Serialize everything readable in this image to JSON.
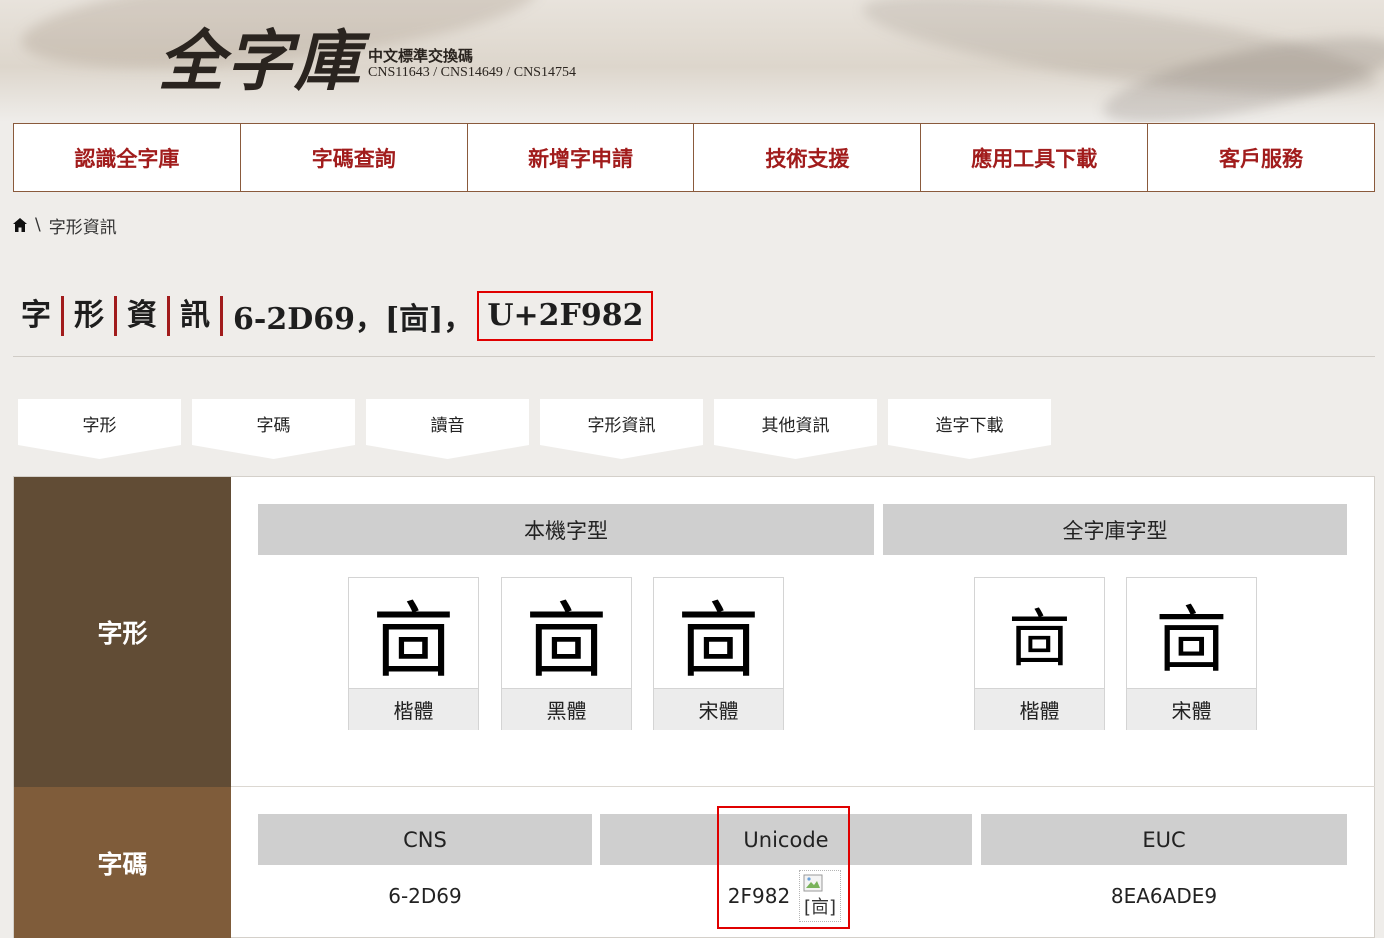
{
  "header": {
    "logo_title": "全字庫",
    "logo_subtitle": "中文標準交換碼",
    "logo_standards": "CNS11643 / CNS14649 / CNS14754"
  },
  "nav": {
    "items": [
      {
        "label": "認識全字庫"
      },
      {
        "label": "字碼查詢"
      },
      {
        "label": "新增字申請"
      },
      {
        "label": "技術支援"
      },
      {
        "label": "應用工具下載"
      },
      {
        "label": "客戶服務"
      }
    ]
  },
  "breadcrumb": {
    "separator": "\\",
    "current": "字形資訊"
  },
  "title": {
    "chars": [
      "字",
      "形",
      "資",
      "訊"
    ],
    "code_text": "6-2D69，[㐭]，",
    "unicode": "U+2F982"
  },
  "tabs": [
    {
      "label": "字形"
    },
    {
      "label": "字碼"
    },
    {
      "label": "讀音"
    },
    {
      "label": "字形資訊"
    },
    {
      "label": "其他資訊"
    },
    {
      "label": "造字下載"
    }
  ],
  "glyph_section": {
    "label": "字形",
    "local_fonts_header": "本機字型",
    "cns_fonts_header": "全字庫字型",
    "glyph_char": "㐭",
    "local_fonts": [
      {
        "label": "楷體"
      },
      {
        "label": "黑體"
      },
      {
        "label": "宋體"
      }
    ],
    "cns_fonts": [
      {
        "label": "楷體"
      },
      {
        "label": "宋體"
      }
    ]
  },
  "code_section": {
    "label": "字碼",
    "columns": [
      {
        "header": "CNS",
        "value": "6-2D69"
      },
      {
        "header": "Unicode",
        "value": "2F982"
      },
      {
        "header": "EUC",
        "value": "8EA6ADE9"
      }
    ],
    "image_alt": "[㐭]"
  },
  "colors": {
    "accent_red": "#a11c1c",
    "highlight_red": "#e00000",
    "row1_bg": "#614c35",
    "row2_bg": "#7f5c3a"
  }
}
